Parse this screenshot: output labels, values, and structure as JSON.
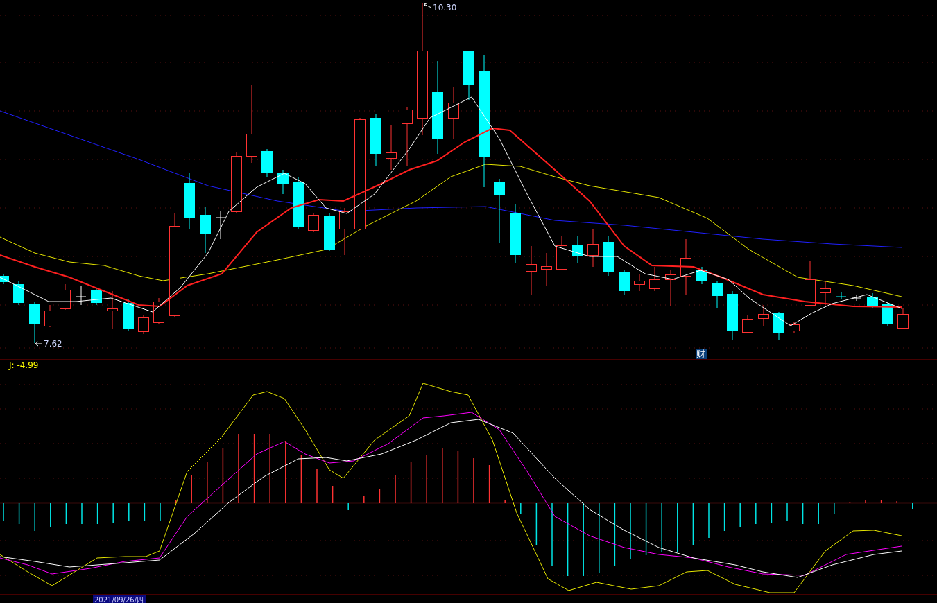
{
  "price_chart": {
    "high_label": "10.30",
    "low_label": "7.62",
    "event_marker": "财"
  },
  "indicator_readout": {
    "j_value": "J: -4.99"
  },
  "date_axis": {
    "date_label": "2021/09/26/四"
  }
}
